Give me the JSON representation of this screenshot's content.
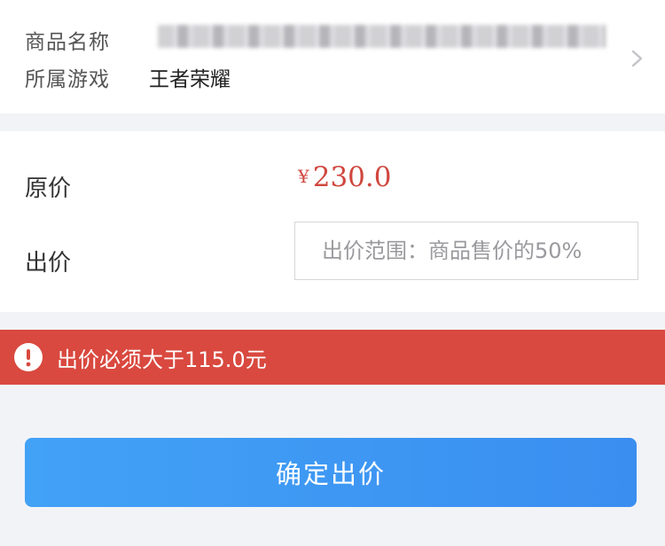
{
  "product": {
    "name_label": "商品名称",
    "game_label": "所属游戏",
    "game_value": "王者荣耀"
  },
  "pricing": {
    "original_label": "原价",
    "currency_symbol": "¥",
    "original_price": "230.0",
    "offer_label": "出价",
    "offer_placeholder": "出价范围：商品售价的50%",
    "offer_value": ""
  },
  "error": {
    "message": "出价必须大于115.0元"
  },
  "actions": {
    "confirm_label": "确定出价"
  },
  "colors": {
    "price_red": "#d0473f",
    "error_bg": "#d9493f",
    "button_blue": "#3d97f3",
    "page_bg": "#f2f3f7"
  },
  "icons": {
    "chevron": "chevron-right-icon",
    "error": "exclamation-circle-icon"
  }
}
